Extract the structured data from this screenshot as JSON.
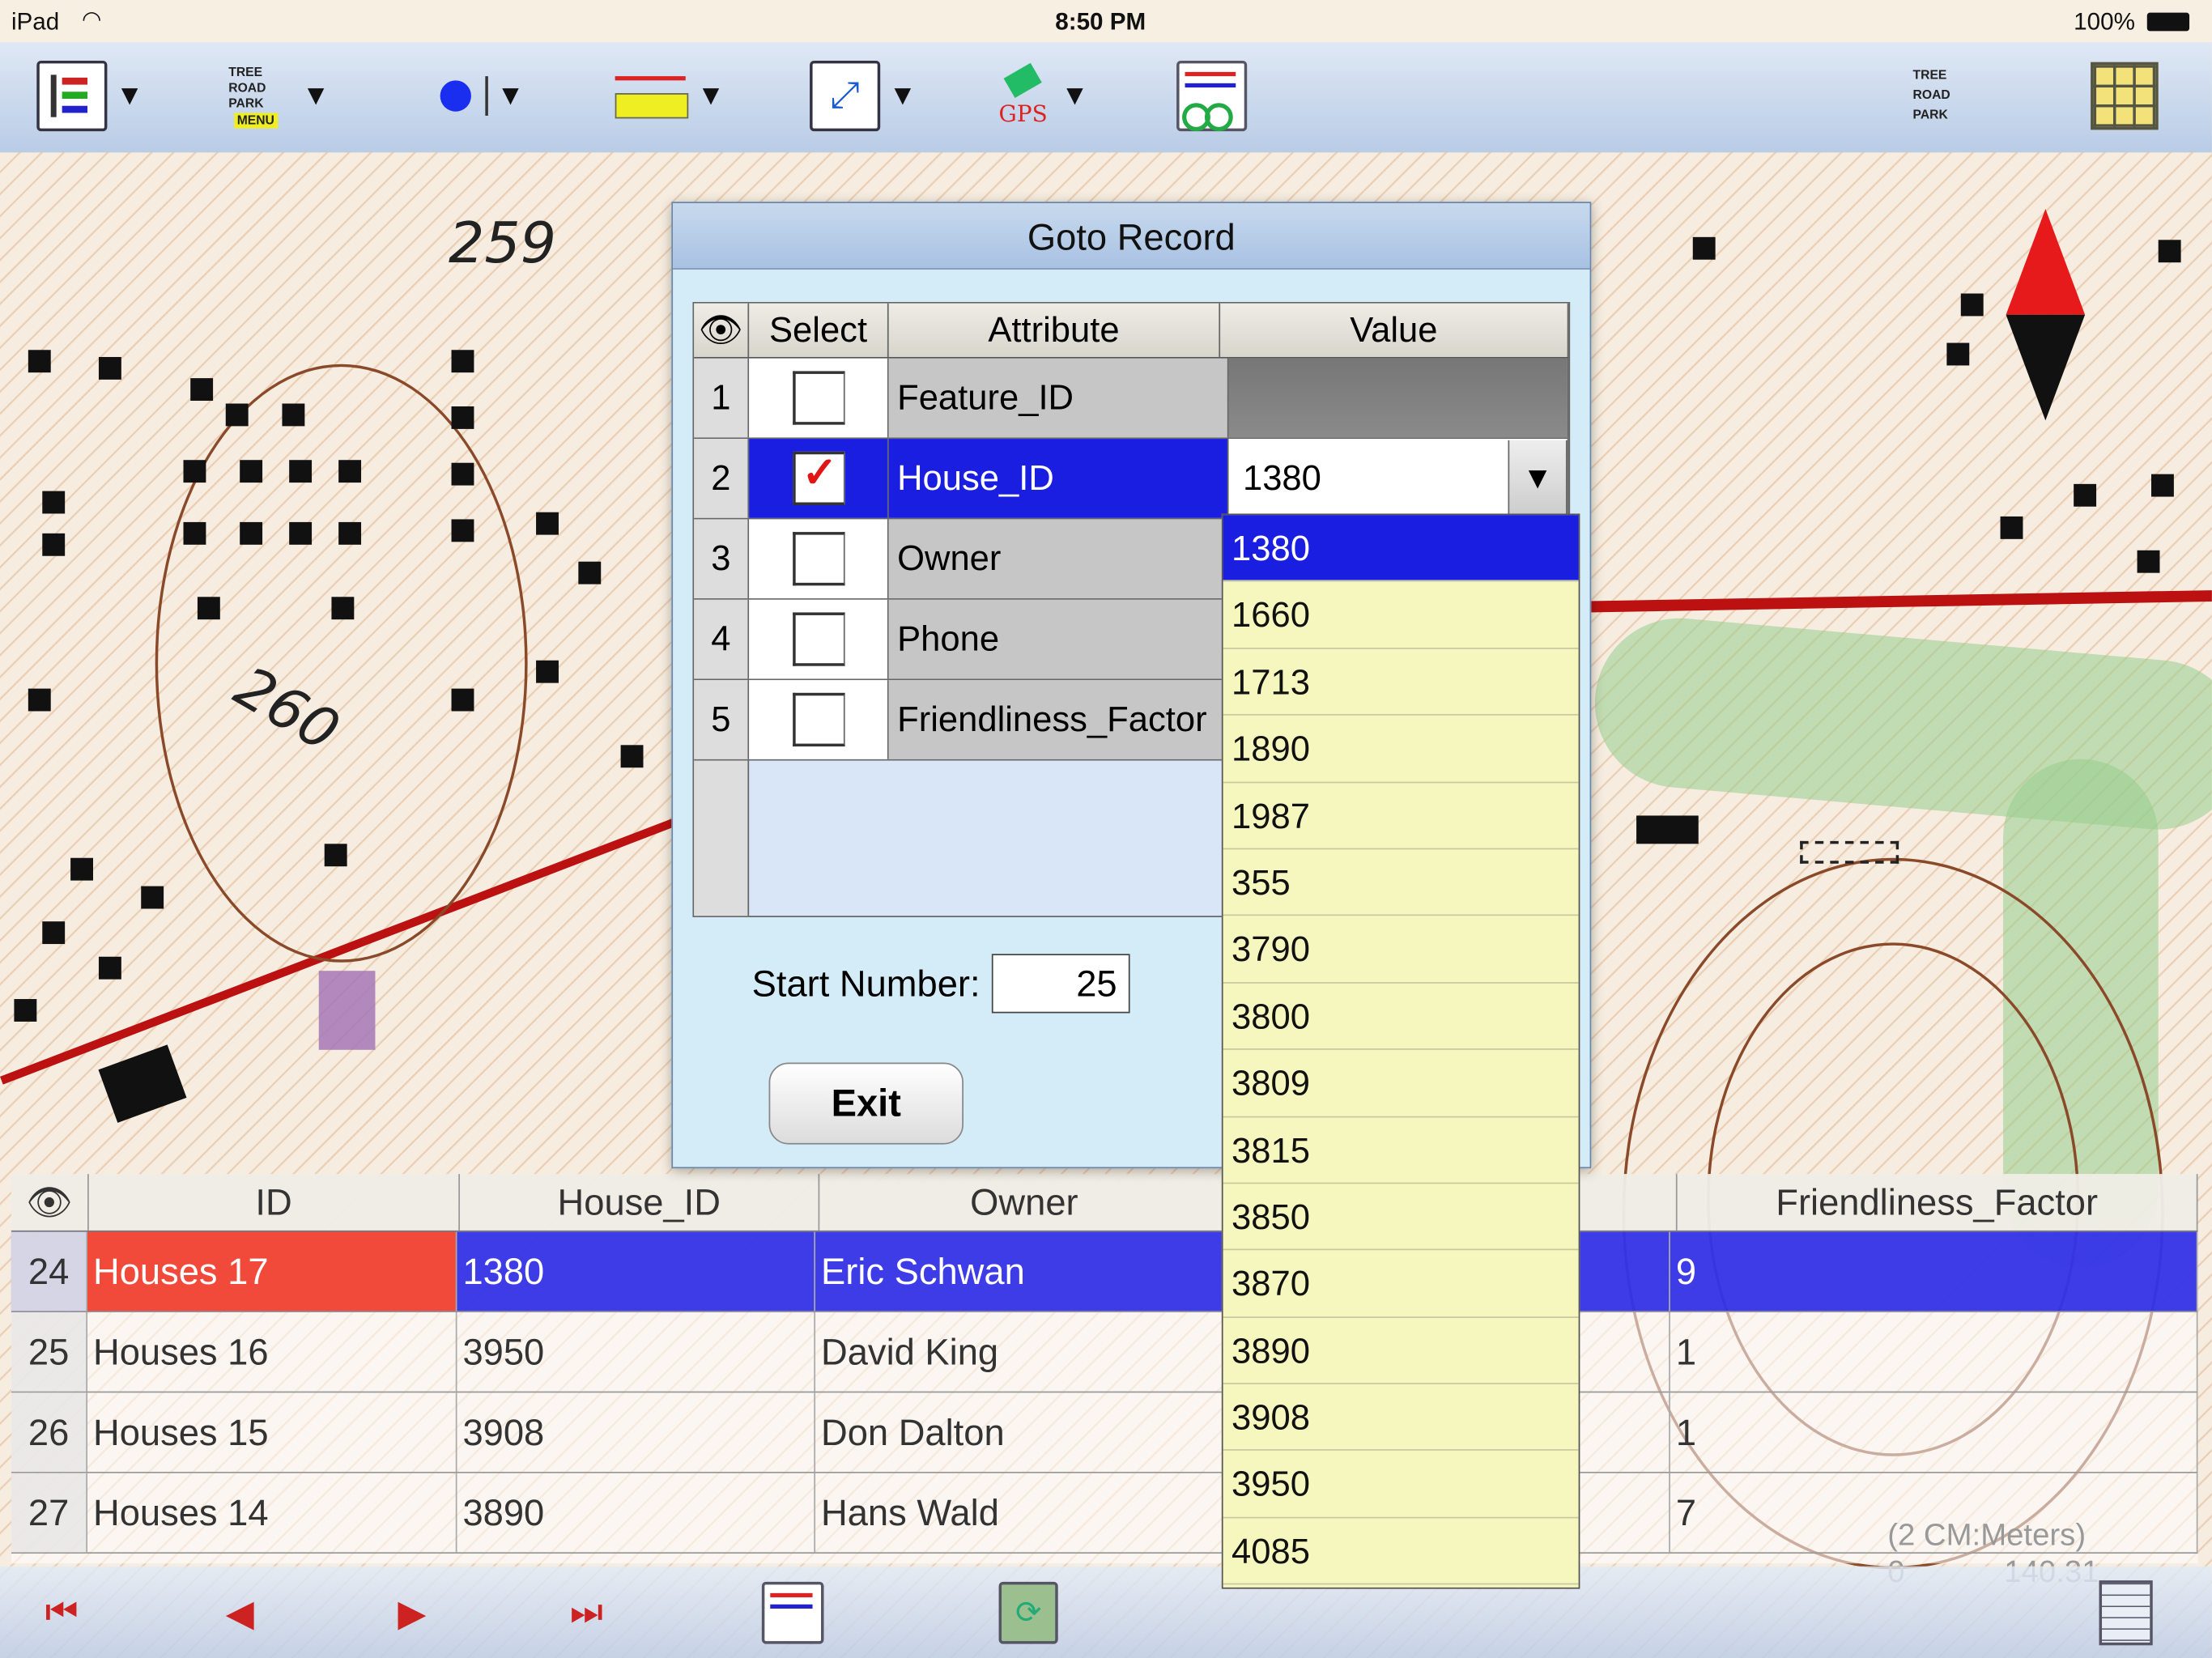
{
  "status_bar": {
    "device": "iPad",
    "time": "8:50 PM",
    "battery": "100%"
  },
  "toolbar": {
    "icons": [
      "layer-list-icon",
      "layer-menu-icon",
      "point-tool-icon",
      "measure-ruler-icon",
      "zoom-extent-icon",
      "gps-icon",
      "attribute-table-icon",
      "layer-toggle-icon",
      "grid-icon"
    ],
    "menu_label": "MENU",
    "gps_label": "GPS",
    "layer_labels": [
      "TREE",
      "ROAD",
      "PARK"
    ]
  },
  "map": {
    "label_259": "259",
    "label_260": "260"
  },
  "dialog": {
    "title": "Goto Record",
    "columns": {
      "select": "Select",
      "attribute": "Attribute",
      "value": "Value"
    },
    "rows": [
      {
        "num": "1",
        "attribute": "Feature_ID",
        "checked": false,
        "value": ""
      },
      {
        "num": "2",
        "attribute": "House_ID",
        "checked": true,
        "value": "1380"
      },
      {
        "num": "3",
        "attribute": "Owner",
        "checked": false,
        "value": ""
      },
      {
        "num": "4",
        "attribute": "Phone",
        "checked": false,
        "value": ""
      },
      {
        "num": "5",
        "attribute": "Friendliness_Factor",
        "checked": false,
        "value": ""
      }
    ],
    "start_label": "Start Number:",
    "start_value": "25",
    "exit_label": "Exit",
    "check_glyph": "✓",
    "dropdown_arrow": "▼"
  },
  "dropdown_options": [
    "1380",
    "1660",
    "1713",
    "1890",
    "1987",
    "355",
    "3790",
    "3800",
    "3809",
    "3815",
    "3850",
    "3870",
    "3890",
    "3908",
    "3950",
    "4085"
  ],
  "dropdown_selected": "1380",
  "table": {
    "columns": {
      "id": "ID",
      "house_id": "House_ID",
      "owner": "Owner",
      "ff": "Friendliness_Factor"
    },
    "rows": [
      {
        "num": "24",
        "id": "Houses 17",
        "house_id": "1380",
        "owner": "Eric Schwan",
        "ff": "9"
      },
      {
        "num": "25",
        "id": "Houses 16",
        "house_id": "3950",
        "owner": "David King",
        "ff": "1"
      },
      {
        "num": "26",
        "id": "Houses 15",
        "house_id": "3908",
        "owner": "Don Dalton",
        "ff": "1"
      },
      {
        "num": "27",
        "id": "Houses 14",
        "house_id": "3890",
        "owner": "Hans Wald",
        "ff": "7"
      }
    ]
  },
  "scale": {
    "units": "(2 CM:Meters)",
    "start": "0",
    "end": "140.31"
  },
  "bottom_toolbar": {
    "icons": [
      "first-record-icon",
      "previous-record-icon",
      "next-record-icon",
      "last-record-icon",
      "attribute-table-icon",
      "refresh-icon",
      "grid-icon"
    ]
  }
}
